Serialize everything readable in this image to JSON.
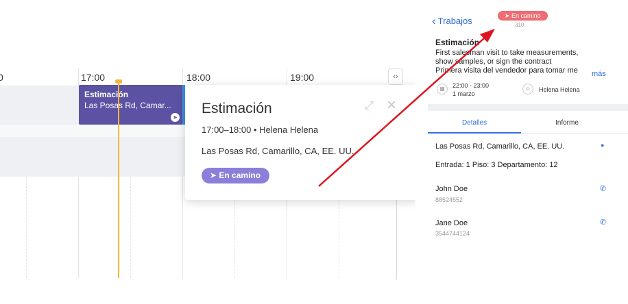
{
  "schedule": {
    "time_labels": [
      "0",
      "17:00",
      "18:00",
      "19:00"
    ],
    "scroll_toggle_label": "‹›",
    "event": {
      "title": "Estimación",
      "address_short": "Las Posas Rd, Camar..."
    },
    "popover": {
      "title": "Estimación",
      "meta": "17:00–18:00 • Helena Helena",
      "address": "Las Posas Rd, Camarillo, CA, EE. UU.",
      "status": "En camino",
      "status_color": "#8b7fd9"
    },
    "event_color": "#5b52a3",
    "now_line_color": "#f5b83d"
  },
  "mobile": {
    "back_label": "Trabajos",
    "status": "En camino",
    "status_color": "#ef6c72",
    "job_code": "310",
    "title": "Estimación",
    "description_lines": [
      "First salesman visit to take measurements,",
      "show samples, or sign the contract",
      "Primera visita del vendedor para tomar me"
    ],
    "more_label": "más",
    "time": "22:00 - 23:00",
    "date": "1 marzo",
    "assignee": "Helena Helena",
    "tabs": [
      "Detalles",
      "Informe"
    ],
    "address": "Las Posas Rd, Camarillo, CA, EE. UU.",
    "address_extra": "Entrada: 1   Piso: 3   Departamento: 12",
    "contacts": [
      {
        "name": "John Doe",
        "phone": "88524552"
      },
      {
        "name": "Jane Doe",
        "phone": "3544744124"
      }
    ]
  },
  "annotation": {
    "arrow_color": "#e0141e"
  }
}
